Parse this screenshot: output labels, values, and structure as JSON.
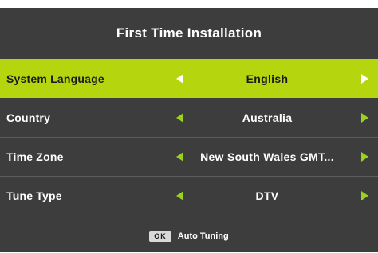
{
  "title": "First Time Installation",
  "settings": [
    {
      "label": "System Language",
      "value": "English"
    },
    {
      "label": "Country",
      "value": "Australia"
    },
    {
      "label": "Time Zone",
      "value": "New South Wales GMT..."
    },
    {
      "label": "Tune Type",
      "value": "DTV"
    }
  ],
  "footer": {
    "key": "OK",
    "action": "Auto Tuning"
  },
  "colors": {
    "highlight": "#b5d60e",
    "arrow": "#9ad11d",
    "background": "#3d3d3d"
  },
  "icons": {
    "left": "arrow-left-icon",
    "right": "arrow-right-icon"
  }
}
